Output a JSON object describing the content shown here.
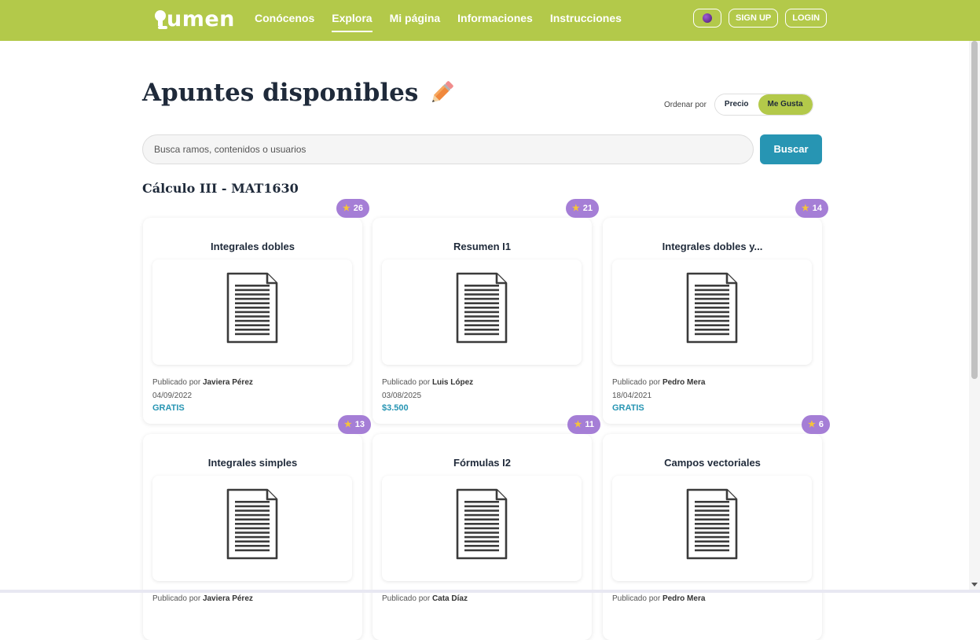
{
  "brand": {
    "name": "umen"
  },
  "nav": {
    "items": [
      {
        "label": "Conócenos"
      },
      {
        "label": "Explora"
      },
      {
        "label": "Mi página"
      },
      {
        "label": "Informaciones"
      },
      {
        "label": "Instrucciones"
      }
    ],
    "active": "Explora"
  },
  "header_actions": {
    "signup": "SIGN UP",
    "login": "LOGIN"
  },
  "page": {
    "title": "Apuntes disponibles",
    "sort_label": "Ordenar por",
    "sort_options": [
      "Precio",
      "Me Gusta"
    ],
    "sort_active": "Me Gusta"
  },
  "search": {
    "placeholder": "Busca ramos, contenidos o usuarios",
    "button": "Buscar"
  },
  "section": {
    "title": "Cálculo III - MAT1630"
  },
  "published_prefix": "Publicado por",
  "cards": [
    {
      "title": "Integrales dobles",
      "likes": "26",
      "author": "Javiera Pérez",
      "date": "04/09/2022",
      "price": "GRATIS"
    },
    {
      "title": "Resumen I1",
      "likes": "21",
      "author": "Luis López",
      "date": "03/08/2025",
      "price": "$3.500"
    },
    {
      "title": "Integrales dobles y...",
      "likes": "14",
      "author": "Pedro Mera",
      "date": "18/04/2021",
      "price": "GRATIS"
    },
    {
      "title": "Integrales simples",
      "likes": "13",
      "author": "Javiera Pérez",
      "date": "",
      "price": ""
    },
    {
      "title": "Fórmulas I2",
      "likes": "11",
      "author": "Cata Díaz",
      "date": "",
      "price": ""
    },
    {
      "title": "Campos vectoriales",
      "likes": "6",
      "author": "Pedro Mera",
      "date": "",
      "price": ""
    }
  ],
  "colors": {
    "header": "#b3c94a",
    "accent": "#2795b3",
    "likes_badge": "#a57ed6",
    "star": "#f5c33b"
  },
  "icons": {
    "theme_toggle": "planet-icon",
    "document": "document-icon",
    "pencil": "pencil-icon",
    "star": "star-icon"
  }
}
